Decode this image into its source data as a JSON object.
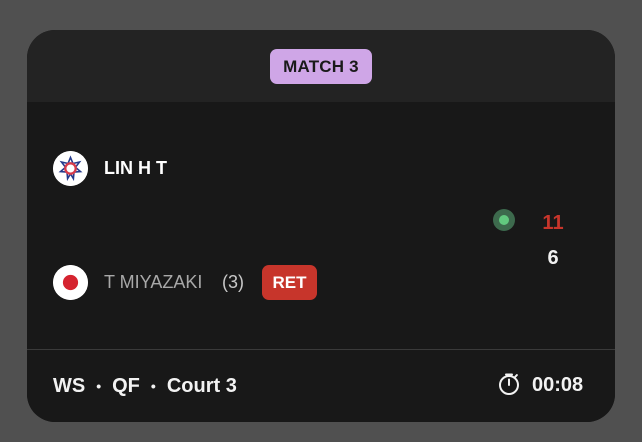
{
  "match": {
    "label": "MATCH 3"
  },
  "players": [
    {
      "name": "LIN H T",
      "flag_icon": "chinese-taipei-flag-icon",
      "score": "11",
      "serving": true
    },
    {
      "name": "T MIYAZAKI",
      "seed": "(3)",
      "flag_icon": "japan-flag-icon",
      "status": "RET",
      "score": "6"
    }
  ],
  "footer": {
    "event": "WS",
    "round": "QF",
    "court": "Court 3",
    "separator": "•",
    "timer_icon": "stopwatch-icon",
    "elapsed": "00:08"
  },
  "colors": {
    "card_background": "#181818",
    "header_background": "#232323",
    "match_badge": "#cfa6e7",
    "score_winner": "#c7352b",
    "retired_badge": "#c7352b",
    "serve_indicator": "#62c97f",
    "muted_player": "#a8a8a8"
  }
}
